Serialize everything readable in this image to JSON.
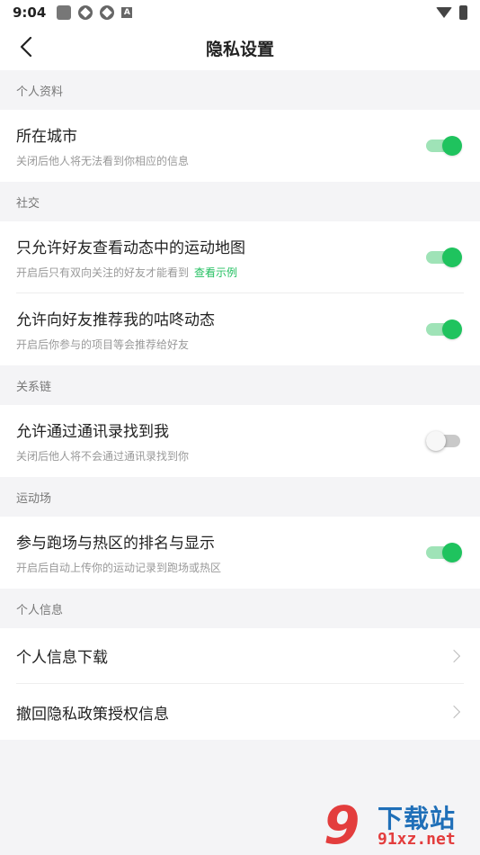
{
  "status_bar": {
    "time": "9:04",
    "a_icon": "A"
  },
  "header": {
    "title": "隐私设置"
  },
  "sections": {
    "profile": {
      "header": "个人资料",
      "city": {
        "title": "所在城市",
        "subtitle": "关闭后他人将无法看到你相应的信息",
        "enabled": true
      }
    },
    "social": {
      "header": "社交",
      "friends_map": {
        "title": "只允许好友查看动态中的运动地图",
        "subtitle": "开启后只有双向关注的好友才能看到",
        "link": "查看示例",
        "enabled": true
      },
      "recommend": {
        "title": "允许向好友推荐我的咕咚动态",
        "subtitle": "开启后你参与的项目等会推荐给好友",
        "enabled": true
      }
    },
    "relations": {
      "header": "关系链",
      "contacts": {
        "title": "允许通过通讯录找到我",
        "subtitle": "关闭后他人将不会通过通讯录找到你",
        "enabled": false
      }
    },
    "arena": {
      "header": "运动场",
      "ranking": {
        "title": "参与跑场与热区的排名与显示",
        "subtitle": "开启后自动上传你的运动记录到跑场或热区",
        "enabled": true
      }
    },
    "personal_info": {
      "header": "个人信息",
      "download": {
        "title": "个人信息下载"
      },
      "revoke": {
        "title": "撤回隐私政策授权信息"
      }
    }
  },
  "watermark": {
    "digit": "9",
    "title": "下载站",
    "domain": "91xz.net"
  },
  "colors": {
    "accent": "#1fc35e",
    "accent_track": "#9fe3b7",
    "background": "#f4f4f6"
  }
}
